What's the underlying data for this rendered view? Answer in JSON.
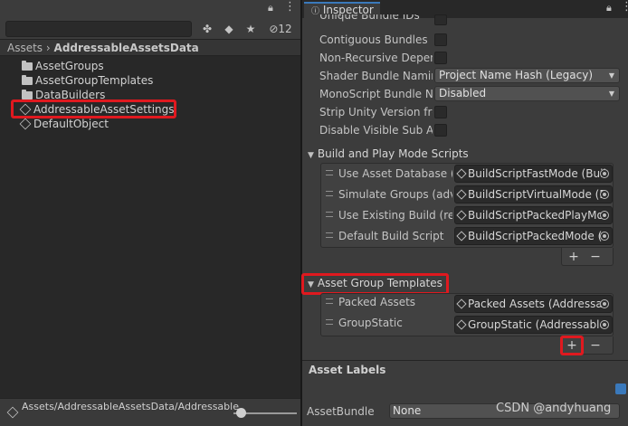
{
  "project": {
    "count_badge": "12",
    "breadcrumb": {
      "root": "Assets",
      "separator": "›",
      "current": "AddressableAssetsData"
    },
    "tree": [
      {
        "label": "AssetGroups",
        "icon": "folder-icon"
      },
      {
        "label": "AssetGroupTemplates",
        "icon": "folder-icon"
      },
      {
        "label": "DataBuilders",
        "icon": "folder-icon"
      },
      {
        "label": "AddressableAssetSettings",
        "icon": "scriptable-object-icon",
        "highlighted": true
      },
      {
        "label": "DefaultObject",
        "icon": "scriptable-object-icon"
      }
    ],
    "status_path": "Assets/AddressableAssetsData/AddressableAssetSettings.asset"
  },
  "inspector": {
    "tab_label": "Inspector",
    "rows": [
      {
        "label": "Unique Bundle IDs",
        "type": "checkbox",
        "checked": false
      },
      {
        "label": "Contiguous Bundles",
        "type": "checkbox",
        "checked": false
      },
      {
        "label": "Non-Recursive Depen",
        "type": "checkbox",
        "checked": false
      },
      {
        "label": "Shader Bundle Naming",
        "type": "dropdown",
        "value": "Project Name Hash (Legacy)"
      },
      {
        "label": "MonoScript Bundle Na",
        "type": "dropdown",
        "value": "Disabled"
      },
      {
        "label": "Strip Unity Version fror",
        "type": "checkbox",
        "checked": false
      },
      {
        "label": "Disable Visible Sub As",
        "type": "checkbox",
        "checked": false
      }
    ],
    "build_scripts": {
      "title": "Build and Play Mode Scripts",
      "items": [
        {
          "label": "Use Asset Database (fa",
          "value": "BuildScriptFastMode (Buil"
        },
        {
          "label": "Simulate Groups (adva",
          "value": "BuildScriptVirtualMode (B"
        },
        {
          "label": "Use Existing Build (req",
          "value": "BuildScriptPackedPlayMo"
        },
        {
          "label": "Default Build Script",
          "value": "BuildScriptPackedMode ("
        }
      ]
    },
    "group_templates": {
      "title": "Asset Group Templates",
      "items": [
        {
          "label": "Packed Assets",
          "value": "Packed Assets (Addressa"
        },
        {
          "label": "GroupStatic",
          "value": "GroupStatic (Addressable"
        }
      ]
    },
    "add_symbol": "+",
    "remove_symbol": "−",
    "labels_section": "Asset Labels",
    "bundle_label": "AssetBundle",
    "bundle_value": "None",
    "watermark": "CSDN @andyhuang"
  }
}
